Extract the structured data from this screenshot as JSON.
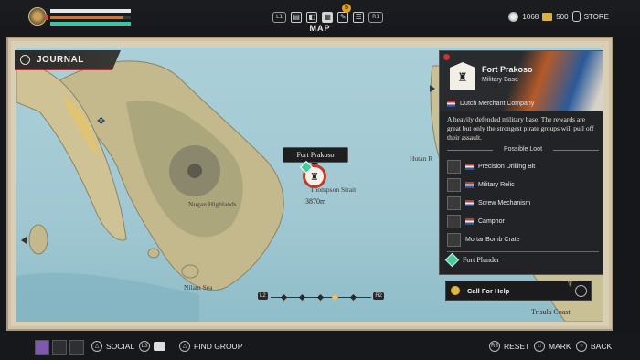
{
  "hud": {
    "tab_buttons": {
      "left": "L1",
      "right": "R1"
    },
    "tab_badge": "5",
    "title": "MAP",
    "bars": {
      "health": 1.0,
      "stamina": 0.9,
      "ship": 1.0
    },
    "silver": "1068",
    "gold": "500",
    "store_label": "STORE"
  },
  "journal": {
    "label": "JOURNAL"
  },
  "map": {
    "labels": {
      "nugan": "Nugan Highlands",
      "nilam": "Nilam Sea",
      "strait": "Thompson Strait",
      "hutan": "Hutan R",
      "trisula": "Trisula Coast"
    },
    "fort_tag": "Fort Prakoso",
    "distance": "3870m",
    "timeline": {
      "left": "L2",
      "right": "R2"
    }
  },
  "panel": {
    "title": "Fort Prakoso",
    "subtitle": "Military Base",
    "faction": "Dutch Merchant Company",
    "description": "A heavily defended military base. The rewards are great but only the strongest pirate groups will pull off their assault.",
    "loot_heading": "Possible Loot",
    "loot": [
      {
        "name": "Precision Drilling Bit",
        "icon": "drill-bit-icon"
      },
      {
        "name": "Military Relic",
        "icon": "relic-icon"
      },
      {
        "name": "Screw Mechanism",
        "icon": "screw-icon"
      },
      {
        "name": "Camphor",
        "icon": "camphor-icon"
      },
      {
        "name": "Mortar Bomb Crate",
        "icon": "crate-icon"
      }
    ],
    "plunder": "Fort Plunder",
    "help": "Call For Help"
  },
  "footer": {
    "social": "SOCIAL",
    "find_group": "FIND GROUP",
    "reset": "RESET",
    "mark": "MARK",
    "back": "BACK"
  },
  "colors": {
    "accent_red": "#c0392b",
    "plunder_green": "#4ac99a",
    "sea": "#a1c8d2",
    "land": "#c9c096"
  }
}
